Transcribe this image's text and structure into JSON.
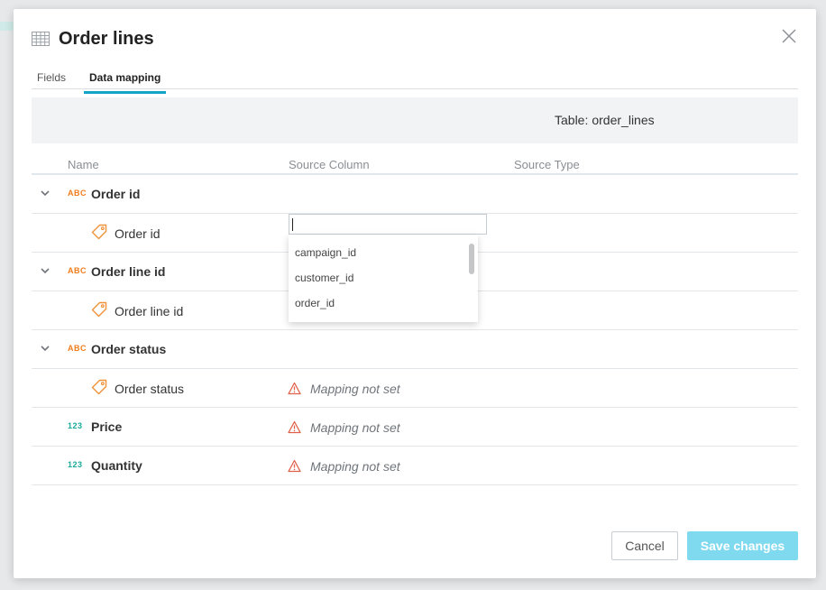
{
  "dialog": {
    "title": "Order lines",
    "icon": "table-icon"
  },
  "tabs": [
    {
      "label": "Fields",
      "active": false
    },
    {
      "label": "Data mapping",
      "active": true
    }
  ],
  "info_bar": {
    "table_label": "Table:",
    "table_name": "order_lines"
  },
  "columns": {
    "name": "Name",
    "source_column": "Source Column",
    "source_type": "Source Type"
  },
  "rows": [
    {
      "kind": "group",
      "type_icon": "ABC",
      "name": "Order id"
    },
    {
      "kind": "field",
      "name": "Order id",
      "mapping": ""
    },
    {
      "kind": "group",
      "type_icon": "ABC",
      "name": "Order line id"
    },
    {
      "kind": "field",
      "name": "Order line id",
      "mapping": ""
    },
    {
      "kind": "group",
      "type_icon": "ABC",
      "name": "Order status"
    },
    {
      "kind": "field",
      "name": "Order status",
      "mapping": "Mapping not set"
    },
    {
      "kind": "leaf",
      "type_icon": "123",
      "name": "Price",
      "mapping": "Mapping not set"
    },
    {
      "kind": "leaf",
      "type_icon": "123",
      "name": "Quantity",
      "mapping": "Mapping not set"
    }
  ],
  "source_input": {
    "value": ""
  },
  "dropdown_options": [
    "campaign_id",
    "customer_id",
    "order_id"
  ],
  "footer": {
    "cancel_label": "Cancel",
    "save_label": "Save changes"
  },
  "colors": {
    "accent": "#12a3c6",
    "save_disabled": "#7fd9ef",
    "text_type_icon": "#f07c1c",
    "number_type_icon": "#18a99a",
    "warning": "#e0604a"
  }
}
